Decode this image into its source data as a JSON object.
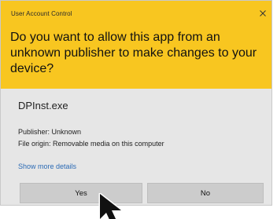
{
  "dialog": {
    "window_title": "User Account Control",
    "question": "Do you want to allow this app from an unknown publisher to make changes to your device?",
    "app_name": "DPInst.exe",
    "publisher": "Publisher: Unknown",
    "file_origin": "File origin: Removable media on this computer",
    "show_more_details": "Show more details",
    "yes_label": "Yes",
    "no_label": "No"
  },
  "colors": {
    "header": "#f8c620",
    "body": "#e6e6e6",
    "button": "#cccccc",
    "link": "#2c6bb5"
  },
  "icons": {
    "close": "close-icon",
    "cursor": "mouse-pointer-icon"
  }
}
